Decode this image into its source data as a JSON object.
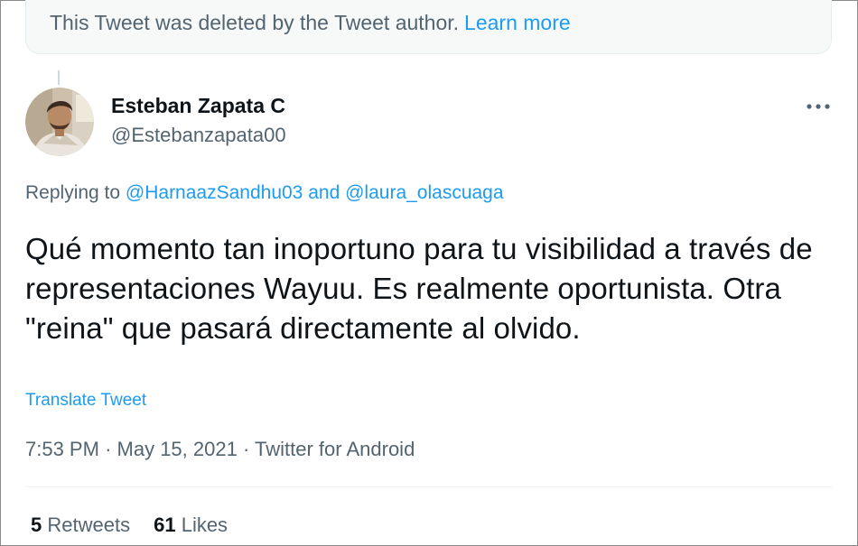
{
  "deleted_notice": {
    "text": "This Tweet was deleted by the Tweet author.",
    "link": "Learn more"
  },
  "author": {
    "name": "Esteban Zapata C",
    "handle": "@Estebanzapata00"
  },
  "more_icon": "more-horizontal-icon",
  "replying": {
    "prefix": "Replying to",
    "user1": "@HarnaazSandhu03",
    "conjunction": "and",
    "user2": "@laura_olascuaga"
  },
  "tweet": {
    "text": "Qué momento tan inoportuno para tu visibilidad a través de representaciones Wayuu. Es realmente oportunista. Otra \"reina\" que pasará directamente al olvido.",
    "translate": "Translate Tweet"
  },
  "meta": {
    "time": "7:53 PM",
    "date": "May 15, 2021",
    "source": "Twitter for Android",
    "separator": "·"
  },
  "stats": {
    "retweets_count": "5",
    "retweets_label": "Retweets",
    "likes_count": "61",
    "likes_label": "Likes"
  },
  "colors": {
    "link": "#1d9bf0",
    "secondary_text": "#536471",
    "primary_text": "#0f1419"
  }
}
